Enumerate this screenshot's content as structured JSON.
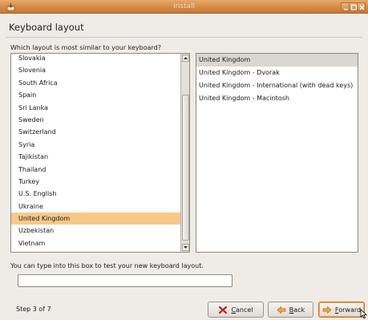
{
  "window": {
    "title": "Install"
  },
  "page": {
    "heading": "Keyboard layout",
    "question": "Which layout is most similar to your keyboard?",
    "hint": "You can type into this box to test your new keyboard layout.",
    "test_input": {
      "value": "",
      "placeholder": ""
    },
    "step": "Step 3 of 7"
  },
  "layouts": {
    "items": [
      "Slovakia",
      "Slovenia",
      "South Africa",
      "Spain",
      "Sri Lanka",
      "Sweden",
      "Switzerland",
      "Syria",
      "Tajikistan",
      "Thailand",
      "Turkey",
      "U.S. English",
      "Ukraine",
      "United Kingdom",
      "Uzbekistan",
      "Vietnam"
    ],
    "selected": "United Kingdom",
    "scroll_position": 0.95
  },
  "variants": {
    "items": [
      "United Kingdom",
      "United Kingdom - Dvorak",
      "United Kingdom - International (with dead keys)",
      "United Kingdom - Macintosh"
    ],
    "selected": "United Kingdom"
  },
  "buttons": {
    "cancel": {
      "mnemonic": "C",
      "rest": "ancel"
    },
    "back": {
      "mnemonic": "B",
      "rest": "ack"
    },
    "forward": {
      "mnemonic": "F",
      "rest": "orward"
    }
  },
  "icons": {
    "app": "installer-icon",
    "cancel": "cancel-icon",
    "back": "back-arrow-icon",
    "forward": "forward-arrow-icon"
  },
  "colors": {
    "titlebar": "#d68a45",
    "selection": "#f8c889",
    "variant_selection": "#dcd6d0",
    "window_bg": "#efebe7"
  }
}
